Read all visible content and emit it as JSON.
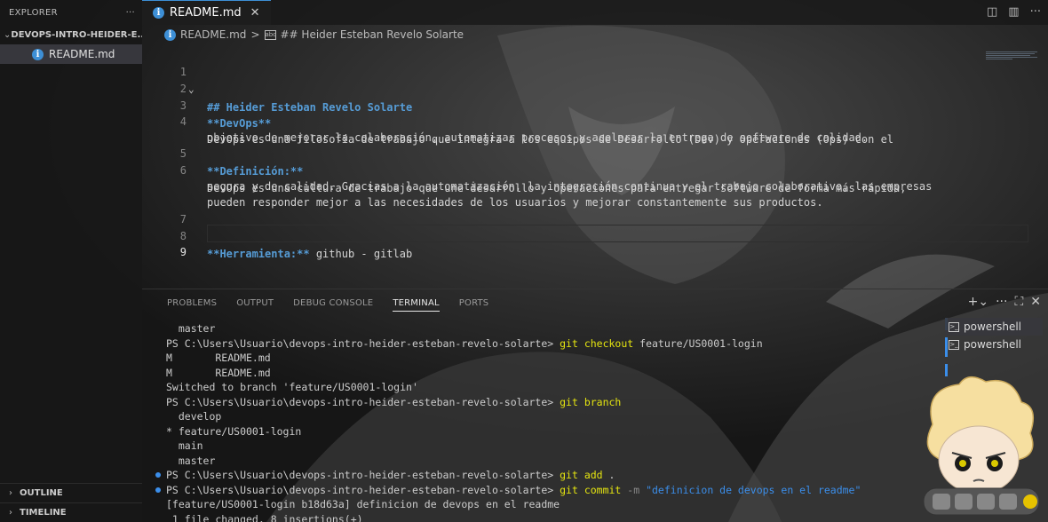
{
  "sidebar": {
    "header": "EXPLORER",
    "more_icon": "ellipsis-icon",
    "folder": "DEVOPS-INTRO-HEIDER-E...",
    "file": "README.md",
    "outline": "OUTLINE",
    "timeline": "TIMELINE"
  },
  "tabs": [
    {
      "label": "README.md"
    }
  ],
  "breadcrumb": {
    "file": "README.md",
    "separator": ">",
    "symbol": "## Heider Esteban Revelo Solarte"
  },
  "editor": {
    "lines": [
      {
        "n": "1",
        "text": "## Heider Esteban Revelo Solarte"
      },
      {
        "n": "2",
        "text": ""
      },
      {
        "n": "3",
        "text": "**DevOps**"
      },
      {
        "n": "4",
        "text": "DevOps es una filosofía de trabajo que integra a los equipos de Desarrollo (Dev) y Operaciones (Ops) con el"
      },
      {
        "n": "",
        "text": "objetivo de mejorar la colaboración, automatizar procesos y acelerar la entrega de software de calidad."
      },
      {
        "n": "5",
        "text": "**Definición:**"
      },
      {
        "n": "6",
        "text": "DevOps es una cultura de trabajo que une desarrollo y operaciones para entregar software de forma más rápida,"
      },
      {
        "n": "",
        "text": "segura y de calidad. Gracias a la automatización, la integración continua y el trabajo colaborativo, las empresas"
      },
      {
        "n": "",
        "text": "pueden responder mejor a las necesidades de los usuarios y mejorar constantemente sus productos."
      },
      {
        "n": "7",
        "text": ""
      },
      {
        "n": "8",
        "text_bold": "**Herramienta:**",
        "text_rest": " github - gitlab"
      },
      {
        "n": "9",
        "text": ""
      }
    ]
  },
  "panel": {
    "tabs": [
      "PROBLEMS",
      "OUTPUT",
      "DEBUG CONSOLE",
      "TERMINAL",
      "PORTS"
    ],
    "active_tab": "TERMINAL",
    "terminals": [
      "powershell",
      "powershell"
    ]
  },
  "terminal": {
    "prompt": "PS C:\\Users\\Usuario\\devops-intro-heider-esteban-revelo-solarte>",
    "lines": {
      "l1": "  master",
      "l2_cmd": "git checkout",
      "l2_arg": " feature/US0001-login",
      "l3": "M       README.md",
      "l4": "M       README.md",
      "l5": "Switched to branch 'feature/US0001-login'",
      "l6_cmd": "git branch",
      "l7": "  develop",
      "l8": "* feature/US0001-login",
      "l9": "  main",
      "l10": "  master",
      "l11_cmd": "git add",
      "l11_arg": " .",
      "l12_cmd": "git commit",
      "l12_flag": " -m ",
      "l12_str": "\"definicion de devops en el readme\"",
      "l13": "[feature/US0001-login b18d63a] definicion de devops en el readme",
      "l14": " 1 file changed, 8 insertions(+)"
    }
  },
  "colors": {
    "accent": "#3b8eea",
    "git_command": "#e5e510",
    "branch_current": "#23d18b",
    "markdown_heading": "#569cd6"
  }
}
